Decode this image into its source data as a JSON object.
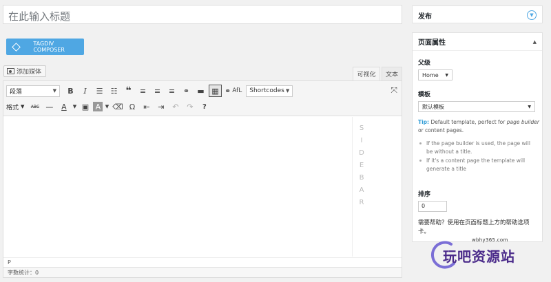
{
  "title_input": {
    "placeholder": "在此输入标题"
  },
  "composer_button": {
    "label": "TAGDIV COMPOSER"
  },
  "media_button": {
    "label": "添加媒体"
  },
  "editor_tabs": [
    {
      "label": "可视化"
    },
    {
      "label": "文本"
    }
  ],
  "toolbar": {
    "format_select": "段落",
    "format_menu": "格式",
    "afl_label": "AfL",
    "shortcodes_select": "Shortcodes",
    "abc_label": "ABC",
    "icons": [
      "bold-icon",
      "italic-icon",
      "bullet-list-icon",
      "numbered-list-icon",
      "blockquote-icon",
      "align-left-icon",
      "align-center-icon",
      "align-right-icon",
      "link-icon",
      "read-more-icon",
      "toolbar-toggle-icon",
      "fullscreen-icon",
      "strikethrough-icon",
      "horizontal-line-icon",
      "text-color-icon",
      "paste-text-icon",
      "background-color-icon",
      "clear-formatting-icon",
      "special-character-icon",
      "outdent-icon",
      "indent-icon",
      "undo-icon",
      "redo-icon",
      "help-icon"
    ]
  },
  "editor": {
    "sidebar_letters": [
      "S",
      "I",
      "D",
      "E",
      "B",
      "A",
      "R"
    ],
    "path": "P",
    "word_count": "字数统计：0"
  },
  "publish_box": {
    "title": "发布"
  },
  "page_attributes": {
    "title": "页面属性",
    "parent_label": "父级",
    "parent_value": "Home",
    "template_label": "模板",
    "template_value": "默认模板",
    "tip_prefix": "Tip:",
    "tip_text": " Default template, perfect for ",
    "tip_italic": "page builder",
    "tip_suffix": " or content pages.",
    "bullets": [
      "If the page builder is used, the page will be without a title.",
      "If it's a content page the template will generate a title"
    ],
    "order_label": "排序",
    "order_value": "0",
    "help_text": "需要帮助？使用在页面标题上方的帮助选项卡。"
  },
  "watermark": {
    "url": "wbhy365.com",
    "text": "玩吧资源站"
  },
  "colors": {
    "accent": "#4fa7e3",
    "watermark": "#4a2a8a"
  }
}
